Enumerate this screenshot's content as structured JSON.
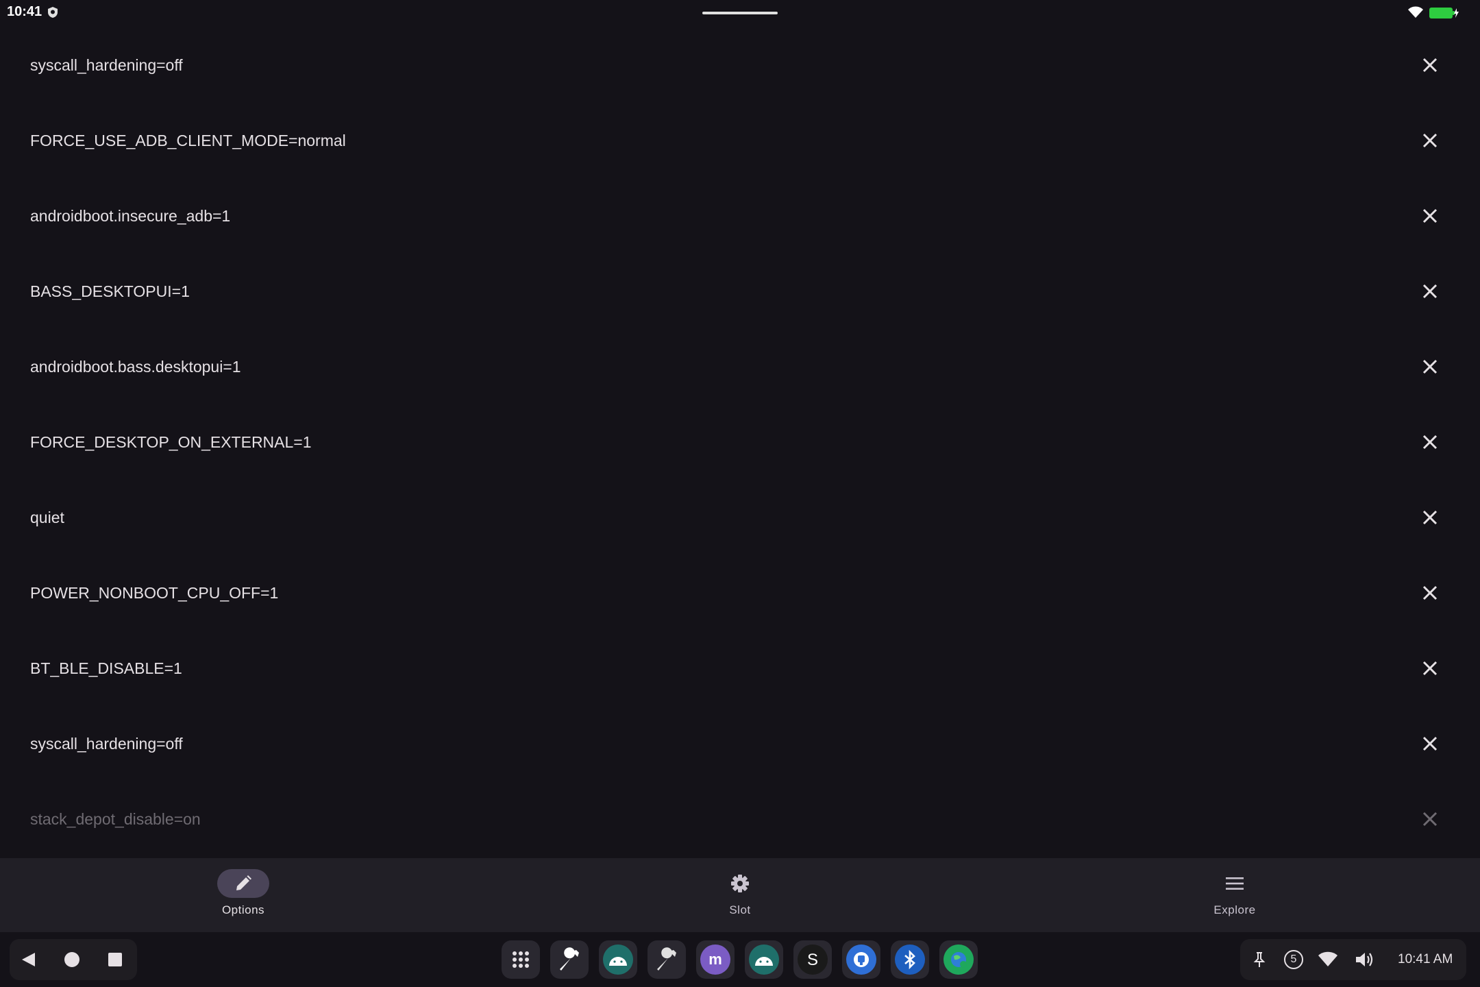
{
  "status_bar": {
    "time": "10:41",
    "icons": [
      "shield-icon",
      "wifi-icon",
      "battery-charging-icon"
    ],
    "battery_color": "#2ecc40"
  },
  "list": {
    "items": [
      {
        "label": "syscall_hardening=off"
      },
      {
        "label": "FORCE_USE_ADB_CLIENT_MODE=normal"
      },
      {
        "label": "androidboot.insecure_adb=1"
      },
      {
        "label": "BASS_DESKTOPUI=1"
      },
      {
        "label": "androidboot.bass.desktopui=1"
      },
      {
        "label": "FORCE_DESKTOP_ON_EXTERNAL=1"
      },
      {
        "label": "quiet"
      },
      {
        "label": "POWER_NONBOOT_CPU_OFF=1"
      },
      {
        "label": "BT_BLE_DISABLE=1"
      },
      {
        "label": "syscall_hardening=off"
      },
      {
        "label": "stack_depot_disable=on"
      }
    ],
    "remove_icon": "close-icon"
  },
  "bottom_nav": {
    "items": [
      {
        "label": "Options",
        "icon": "pencil-icon",
        "active": true
      },
      {
        "label": "Slot",
        "icon": "gear-icon",
        "active": false
      },
      {
        "label": "Explore",
        "icon": "menu-icon",
        "active": false
      }
    ]
  },
  "taskbar": {
    "nav_icons": [
      "back-icon",
      "home-icon",
      "recents-icon"
    ],
    "apps": [
      "app-drawer-icon",
      "wrench-app-icon",
      "android-app-icon",
      "wrench-app-icon",
      "m-app-icon",
      "android-app-icon",
      "s-app-icon",
      "usb-app-icon",
      "bluetooth-app-icon",
      "globe-app-icon"
    ],
    "tray": {
      "notification_count": "5",
      "time": "10:41 AM",
      "icons": [
        "pin-icon",
        "notification-count-icon",
        "wifi-icon",
        "volume-icon"
      ]
    }
  }
}
